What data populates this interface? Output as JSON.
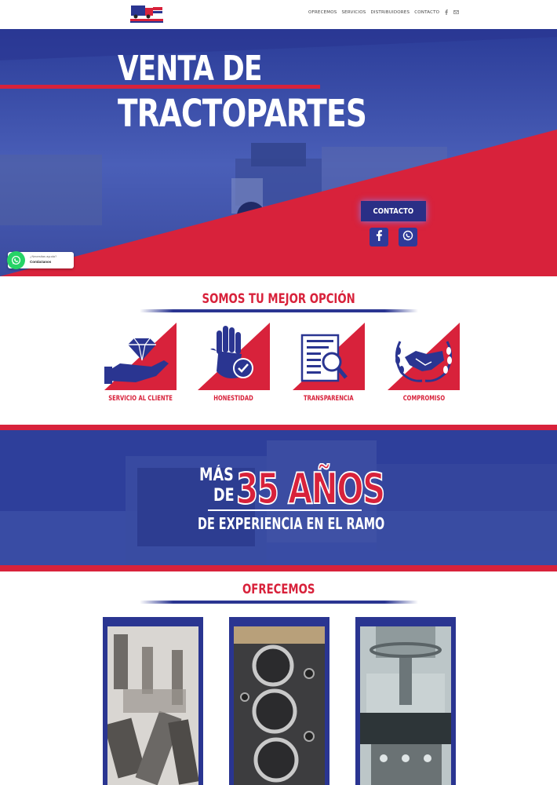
{
  "header": {
    "logo_icon": "truck-logo",
    "nav": [
      "OFRECEMOS",
      "SERVICIOS",
      "DISTRIBUIDORES",
      "CONTACTO"
    ],
    "icons": [
      "facebook-icon",
      "mail-icon"
    ]
  },
  "hero": {
    "title_line1": "VENTA DE",
    "title_line2": "TRACTOPARTES",
    "contact_button": "CONTACTO",
    "social": [
      "facebook-icon",
      "whatsapp-icon"
    ]
  },
  "whatsapp_widget": {
    "question": "¿Necesitas ayuda?",
    "action": "Contáctanos"
  },
  "values_section": {
    "title": "SOMOS TU MEJOR OPCIÓN",
    "items": [
      {
        "label": "SERVICIO AL CLIENTE",
        "icon": "diamond-hand-icon"
      },
      {
        "label": "HONESTIDAD",
        "icon": "raised-hand-check-icon"
      },
      {
        "label": "TRANSPARENCIA",
        "icon": "document-magnifier-icon"
      },
      {
        "label": "COMPROMISO",
        "icon": "handshake-laurel-icon"
      }
    ]
  },
  "banner": {
    "mas": "MÁS",
    "de": "DE",
    "number": "35 AÑOS",
    "experience": "DE EXPERIENCIA EN EL RAMO"
  },
  "offers_section": {
    "title": "OFRECEMOS",
    "items": [
      {
        "image": "injector-parts-photo"
      },
      {
        "image": "engine-block-photo"
      },
      {
        "image": "machining-equipment-photo"
      }
    ]
  },
  "colors": {
    "brand_red": "#d8223b",
    "brand_blue": "#2a3591",
    "hero_blue": "#2c3f9a"
  }
}
